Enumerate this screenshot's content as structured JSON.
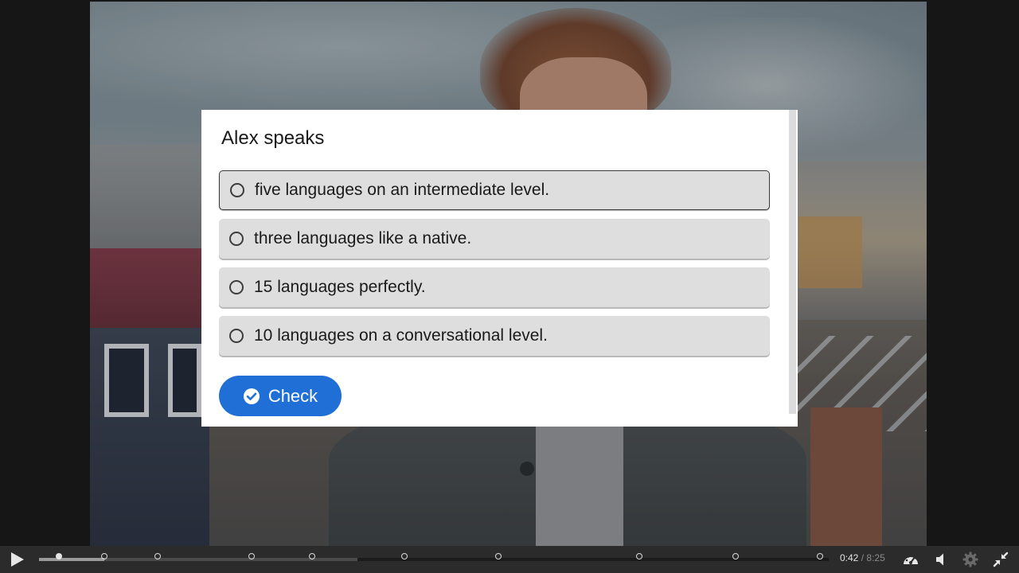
{
  "quiz": {
    "question": "Alex speaks",
    "answers": [
      {
        "label": "five languages on an intermediate level."
      },
      {
        "label": "three languages like a native."
      },
      {
        "label": "15 languages perfectly."
      },
      {
        "label": "10 languages on a conversational level."
      }
    ],
    "check_label": "Check"
  },
  "player": {
    "current_time": "0:42",
    "separator": "/",
    "duration": "8:25",
    "progress_fraction": 0.083,
    "icons": {
      "play": "play-icon",
      "speed": "speed-gauge-icon",
      "volume": "volume-icon",
      "settings": "gear-icon",
      "fullscreen": "exit-fullscreen-icon"
    }
  },
  "colors": {
    "accent": "#1f6fd6",
    "answer_bg": "#dedede",
    "bar_bg": "#2b2b2b"
  }
}
